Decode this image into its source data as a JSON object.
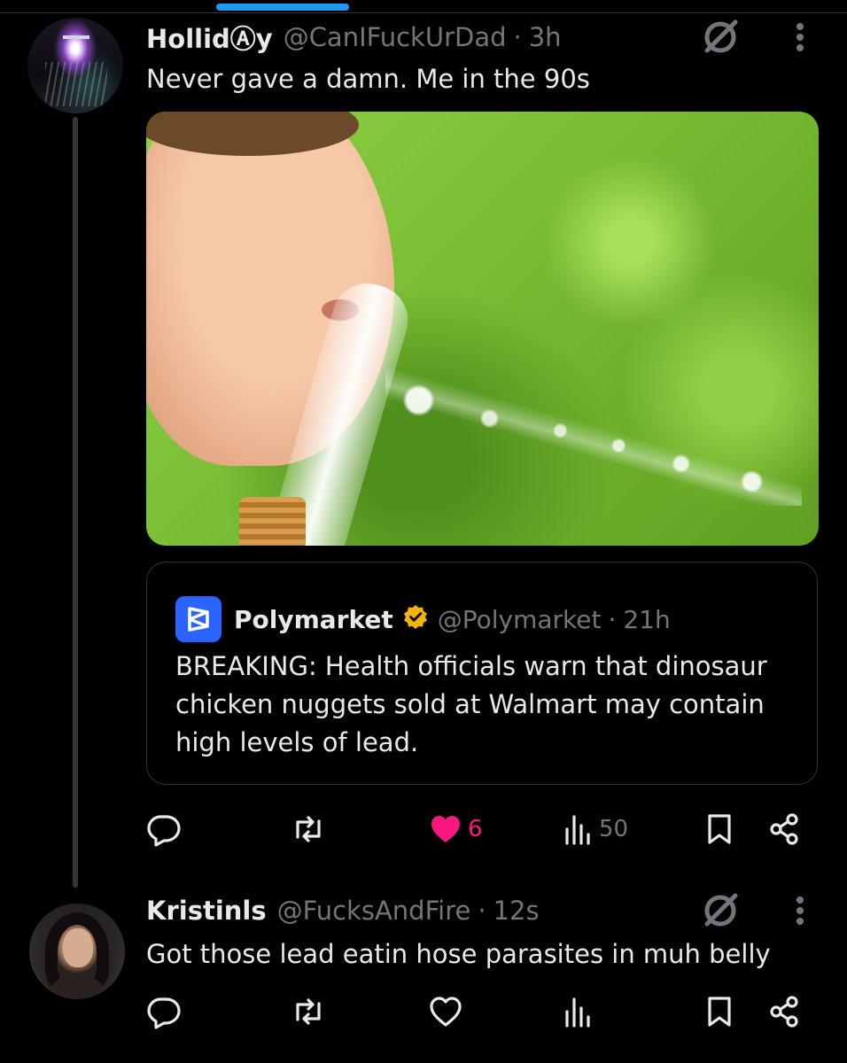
{
  "colors": {
    "background": "#000000",
    "primary_text": "#e7e9ea",
    "secondary_text": "#71767b",
    "accent_blue": "#1d9bf0",
    "like_pink": "#f91880",
    "verified_gold": "#f4b400",
    "divider": "#2f3336"
  },
  "icons": {
    "grok": "grok-icon",
    "more": "more-dots-icon",
    "reply": "reply-icon",
    "repost": "repost-icon",
    "like_filled": "heart-filled-icon",
    "like_outline": "heart-outline-icon",
    "views": "views-icon",
    "bookmark": "bookmark-icon",
    "share": "share-icon",
    "verified": "verified-badge-icon"
  },
  "tweet_1": {
    "display_name": "HollidⒶy",
    "handle": "@CanIFuckUrDad",
    "dot": "·",
    "time": "3h",
    "text": "Never gave a damn. Me in the 90s",
    "quote": {
      "display_name": "Polymarket",
      "handle": "@Polymarket",
      "dot": "·",
      "time": "21h",
      "text": "BREAKING: Health officials warn that dinosaur chicken nuggets sold at Walmart may contain high levels of lead."
    },
    "actions": {
      "likes": "6",
      "views": "50"
    }
  },
  "tweet_2": {
    "display_name": "Kristinls",
    "handle": "@FucksAndFire",
    "dot": "·",
    "time": "12s",
    "text": "Got those lead eatin hose parasites in muh belly"
  }
}
